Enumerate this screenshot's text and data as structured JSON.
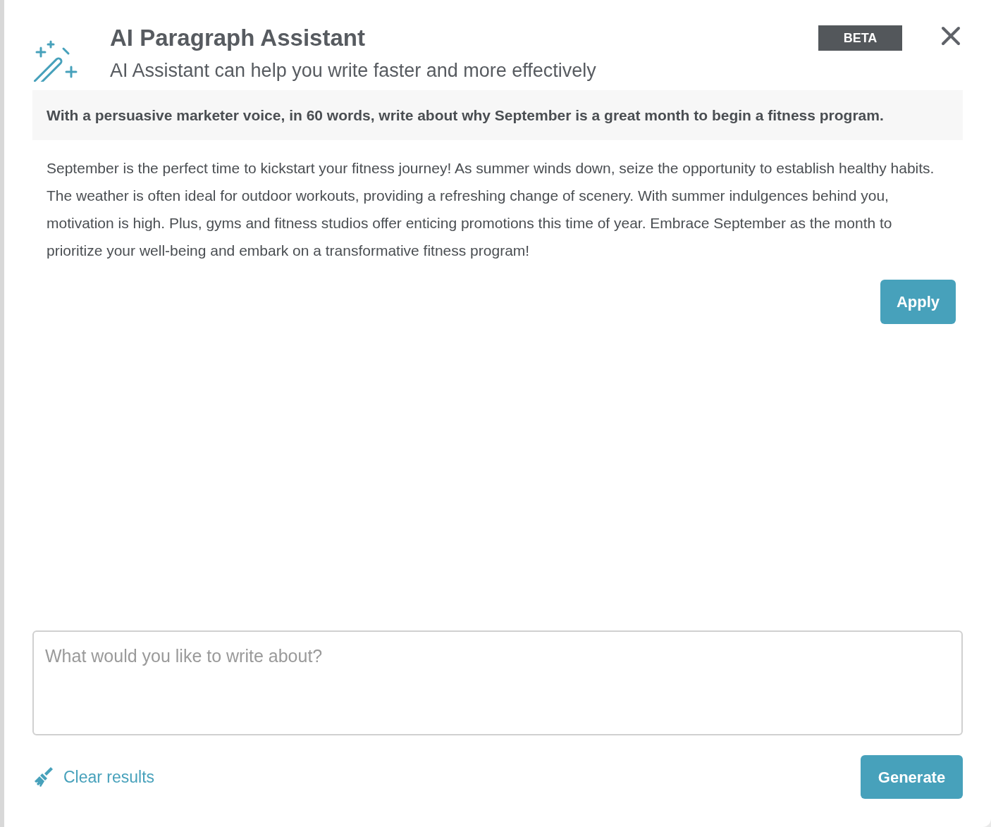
{
  "dialog": {
    "title": "AI Paragraph Assistant",
    "subtitle": "AI Assistant can help you write faster and more effectively",
    "badge": "BETA"
  },
  "prompt": "With a persuasive marketer voice, in 60 words, write about why September is a great month to begin a fitness program.",
  "result": "September is the perfect time to kickstart your fitness journey! As summer winds down, seize the opportunity to establish healthy habits. The weather is often ideal for outdoor workouts, providing a refreshing change of scenery. With summer indulgences behind you, motivation is high. Plus, gyms and fitness studios offer enticing promotions this time of year. Embrace September as the month to prioritize your well-being and embark on a transformative fitness program!",
  "apply_button": "Apply",
  "input": {
    "placeholder": "What would you like to write about?"
  },
  "clear_link": "Clear results",
  "generate_button": "Generate"
}
